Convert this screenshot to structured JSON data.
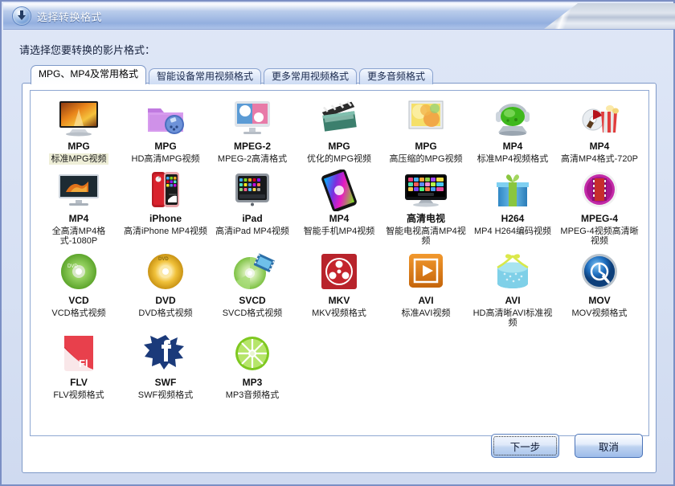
{
  "window": {
    "title": "选择转换格式",
    "title_icon": "download-circle-icon",
    "accent": "#93afdf",
    "body_bg": "#dbe4f5",
    "selection_highlight": "#efefd8"
  },
  "prompt": "请选择您要转换的影片格式：",
  "tabs": [
    {
      "label": "MPG、MP4及常用格式",
      "active": true
    },
    {
      "label": "智能设备常用视频格式",
      "active": false
    },
    {
      "label": "更多常用视频格式",
      "active": false
    },
    {
      "label": "更多音频格式",
      "active": false
    }
  ],
  "formats": [
    {
      "code": "MPG",
      "desc": "标准MPG视频",
      "icon": "tv-autumn-icon",
      "selected": true
    },
    {
      "code": "MPG",
      "desc": "HD高清MPG视频",
      "icon": "purple-folder-icon",
      "selected": false
    },
    {
      "code": "MPEG-2",
      "desc": "MPEG-2高清格式",
      "icon": "monitor-dots-icon",
      "selected": false
    },
    {
      "code": "MPG",
      "desc": "优化的MPG视频",
      "icon": "clapperboard-icon",
      "selected": false
    },
    {
      "code": "MPG",
      "desc": "高压缩的MPG视频",
      "icon": "photo-frame-icon",
      "selected": false
    },
    {
      "code": "MP4",
      "desc": "标准MP4视频格式",
      "icon": "green-headphone-icon",
      "selected": false
    },
    {
      "code": "MP4",
      "desc": "高清MP4格式-720P",
      "icon": "popcorn-disc-icon",
      "selected": false
    },
    {
      "code": "MP4",
      "desc": "全高清MP4格式-1080P",
      "icon": "widescreen-tv-icon",
      "selected": false
    },
    {
      "code": "iPhone",
      "desc": "高清iPhone MP4视频",
      "icon": "iphone-red-icon",
      "selected": false
    },
    {
      "code": "iPad",
      "desc": "高清iPad MP4视频",
      "icon": "ipad-icon",
      "selected": false
    },
    {
      "code": "MP4",
      "desc": "智能手机MP4视频",
      "icon": "smartphone-tilt-icon",
      "selected": false
    },
    {
      "code": "高清电视",
      "desc": "智能电视高清MP4视频",
      "icon": "smart-tv-icon",
      "selected": false
    },
    {
      "code": "H264",
      "desc": "MP4 H264编码视频",
      "icon": "gift-box-green-icon",
      "selected": false
    },
    {
      "code": "MPEG-4",
      "desc": "MPEG-4视频高清晰视频",
      "icon": "film-circle-icon",
      "selected": false
    },
    {
      "code": "VCD",
      "desc": "VCD格式视频",
      "icon": "green-disc-icon",
      "selected": false
    },
    {
      "code": "DVD",
      "desc": "DVD格式视频",
      "icon": "gold-disc-icon",
      "selected": false
    },
    {
      "code": "SVCD",
      "desc": "SVCD格式视频",
      "icon": "disc-film-icon",
      "selected": false
    },
    {
      "code": "MKV",
      "desc": "MKV视频格式",
      "icon": "red-reel-icon",
      "selected": false
    },
    {
      "code": "AVI",
      "desc": "标准AVI视频",
      "icon": "orange-play-icon",
      "selected": false
    },
    {
      "code": "AVI",
      "desc": "HD高清晰AVI标准视频",
      "icon": "gift-box-blue-icon",
      "selected": false
    },
    {
      "code": "MOV",
      "desc": "MOV视频格式",
      "icon": "quicktime-icon",
      "selected": false
    },
    {
      "code": "FLV",
      "desc": "FLV视频格式",
      "icon": "flash-fl-icon",
      "selected": false
    },
    {
      "code": "SWF",
      "desc": "SWF视频格式",
      "icon": "flash-splat-icon",
      "selected": false
    },
    {
      "code": "MP3",
      "desc": "MP3音频格式",
      "icon": "lime-slice-icon",
      "selected": false
    }
  ],
  "buttons": {
    "next": "下一步",
    "cancel": "取消"
  }
}
